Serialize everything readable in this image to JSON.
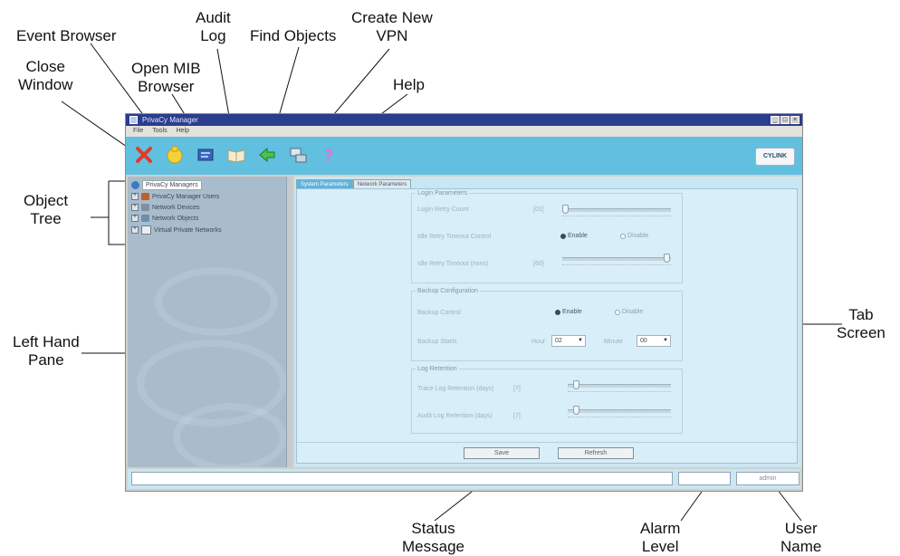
{
  "callouts": {
    "close_window": "Close\nWindow",
    "event_browser": "Event Browser",
    "open_mib_browser": "Open MIB\nBrowser",
    "audit_log": "Audit\nLog",
    "find_objects": "Find Objects",
    "create_new_vpn": "Create New\nVPN",
    "help": "Help",
    "object_tree": "Object\nTree",
    "left_hand_pane": "Left Hand\nPane",
    "tab_screen": "Tab\nScreen",
    "status_message": "Status\nMessage",
    "alarm_level": "Alarm\nLevel",
    "user_name": "User\nName"
  },
  "window": {
    "title": "PrivaCy Manager",
    "menu": [
      "File",
      "Tools",
      "Help"
    ],
    "brand": "CYLINK"
  },
  "toolbar_icons": [
    "close-icon",
    "event-browser-icon",
    "mib-browser-icon",
    "audit-log-icon",
    "find-objects-icon",
    "vpn-icon",
    "help-icon"
  ],
  "tree": {
    "root": "PrivaCy Managers",
    "items": [
      "PrivaCy Manager Users",
      "Network Devices",
      "Network Objects",
      "Virtual Private Networks"
    ]
  },
  "tabs": [
    "System Parameters",
    "Network Parameters"
  ],
  "login_params": {
    "title": "Login Parameters",
    "retry_label": "Login Retry Count",
    "retry_value": "[01]",
    "idle_control_label": "Idle Retry Timeout Control",
    "enable": "Enable",
    "disable": "Disable",
    "idle_minutes_label": "Idle Retry Timeout (mins)",
    "idle_minutes_value": "[60]"
  },
  "backup": {
    "title": "Backup Configuration",
    "control_label": "Backup Control",
    "enable": "Enable",
    "disable": "Disable",
    "starts_label": "Backup Starts",
    "hour_label": "Hour",
    "hour_value": "02",
    "minute_label": "Minute",
    "minute_value": "00"
  },
  "log_retention": {
    "title": "Log Retention",
    "trace_label": "Trace Log Retention (days)",
    "trace_value": "[7]",
    "audit_label": "Audit Log Retention (days)",
    "audit_value": "[7]"
  },
  "buttons": {
    "save": "Save",
    "refresh": "Refresh"
  },
  "statusbar": {
    "message": "",
    "alarm": "",
    "user": "admin"
  },
  "colors": {
    "toolbar": "#61bfe0",
    "titlebar": "#2b3d8f",
    "left_pane": "#a8bccb",
    "tab_area": "#c9e6f4"
  }
}
